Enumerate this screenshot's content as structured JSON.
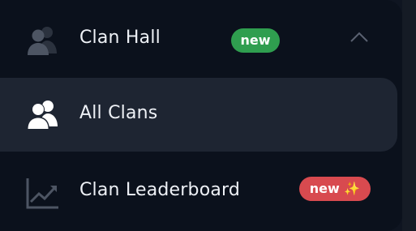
{
  "menu": {
    "clan_hall": {
      "label": "Clan Hall",
      "badge": "new",
      "icon": "users-icon",
      "expanded": true
    },
    "all_clans": {
      "label": "All Clans",
      "icon": "users-icon",
      "active": true
    },
    "leaderboard": {
      "label": "Clan Leaderboard",
      "badge": "new ✨",
      "icon": "trending-up-icon"
    }
  },
  "colors": {
    "background": "#0b111c",
    "active_row": "#1e2532",
    "badge_green": "#2f9e4f",
    "badge_red": "#d84a4f",
    "text": "#eef1f6",
    "icon_muted": "#4d5563"
  }
}
